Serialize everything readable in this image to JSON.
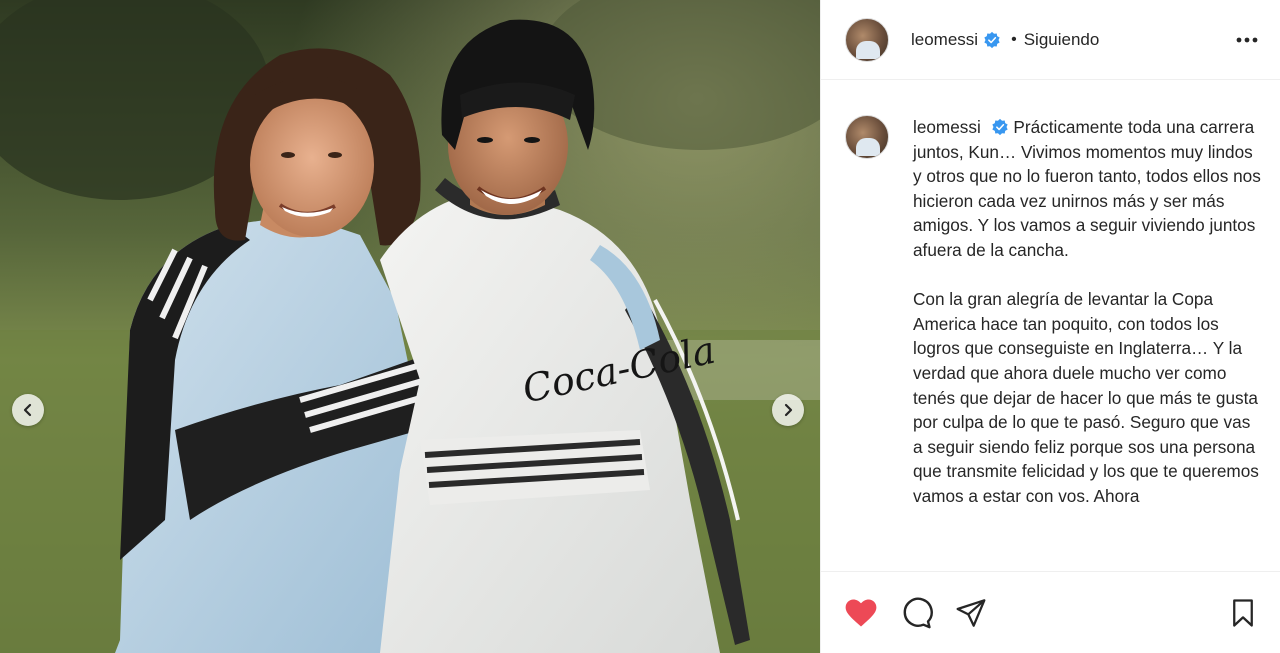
{
  "post": {
    "username": "leomessi",
    "follow_status": "Siguiendo",
    "separator": "•"
  },
  "caption": {
    "username": "leomessi",
    "paragraph_1": "Prácticamente toda una carrera juntos, Kun… Vivimos momentos muy lindos y otros que no lo fueron tanto, todos ellos nos hicieron cada vez unirnos más y ser más amigos. Y los vamos a seguir viviendo juntos afuera de la cancha.",
    "paragraph_2": "Con la gran alegría de levantar la Copa America hace tan poquito, con todos los logros que conseguiste en Inglaterra… Y la verdad que ahora duele mucho ver como tenés que dejar de hacer lo que más te gusta por culpa de lo que te pasó. Seguro que vas a seguir siendo feliz porque sos una persona que transmite felicidad y los que te queremos vamos a estar con vos. Ahora"
  },
  "photo": {
    "jersey_text": "Coca-Cola"
  },
  "colors": {
    "like_red": "#ed4956",
    "verified_blue": "#3897f0",
    "text": "#262626",
    "border": "#efefef"
  },
  "icons": {
    "like": "heart-icon",
    "comment": "comment-icon",
    "share": "paper-plane-icon",
    "save": "bookmark-icon",
    "more": "ellipsis-icon",
    "verified": "verified-badge-icon",
    "prev": "chevron-left-icon",
    "next": "chevron-right-icon"
  }
}
